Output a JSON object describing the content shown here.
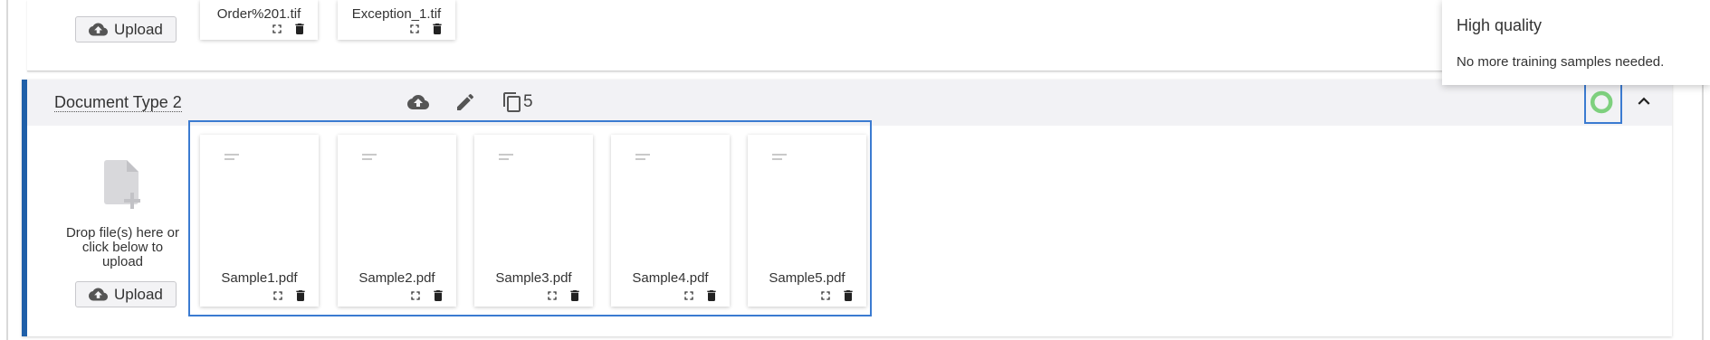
{
  "top_section": {
    "upload_label": "Upload",
    "files": [
      {
        "name": "Order%201.tif"
      },
      {
        "name": "Exception_1.tif"
      }
    ]
  },
  "section": {
    "title": "Document Type 2",
    "count": "5",
    "drop_text": "Drop file(s) here or click below to upload",
    "upload_label": "Upload",
    "files": [
      {
        "name": "Sample1.pdf"
      },
      {
        "name": "Sample2.pdf"
      },
      {
        "name": "Sample3.pdf"
      },
      {
        "name": "Sample4.pdf"
      },
      {
        "name": "Sample5.pdf"
      }
    ],
    "quality_color": "#7ed07e",
    "accent_color": "#1f5fa8"
  },
  "tooltip": {
    "title": "High quality",
    "message": "No more training samples needed."
  },
  "icons": {
    "upload": "cloud-upload-icon",
    "edit": "pencil-icon",
    "copy": "copy-icon",
    "fullscreen": "expand-icon",
    "delete": "trash-icon",
    "file_add": "file-add-icon",
    "quality": "quality-ring-icon",
    "collapse": "chevron-up-icon"
  }
}
